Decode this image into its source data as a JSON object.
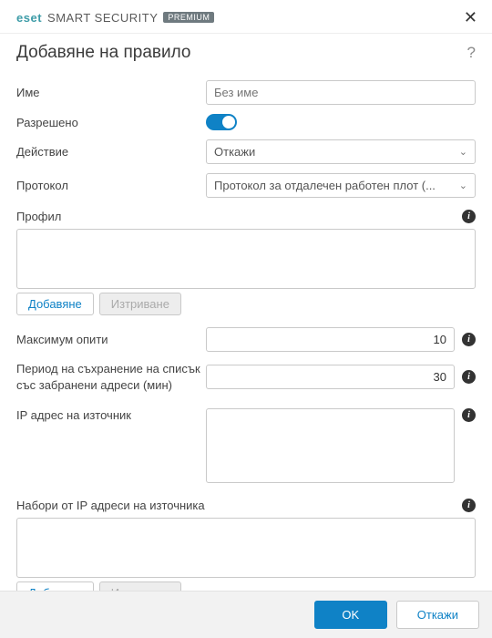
{
  "brand": {
    "eset": "eset",
    "product": "SMART SECURITY",
    "badge": "PREMIUM"
  },
  "title": "Добавяне на правило",
  "labels": {
    "name": "Име",
    "enabled": "Разрешено",
    "action": "Действие",
    "protocol": "Протокол",
    "profile": "Профил",
    "max_attempts": "Максимум опити",
    "block_period": "Период на съхранение на списък със забранени адреси (мин)",
    "source_ip": "IP адрес на източник",
    "source_ip_sets": "Набори от IP адреси на източника"
  },
  "values": {
    "name_placeholder": "Без име",
    "action": "Откажи",
    "protocol": "Протокол за отдалечен работен плот (...",
    "max_attempts": "10",
    "block_period": "30"
  },
  "buttons": {
    "add": "Добавяне",
    "delete": "Изтриване",
    "ok": "OK",
    "cancel": "Откажи"
  }
}
